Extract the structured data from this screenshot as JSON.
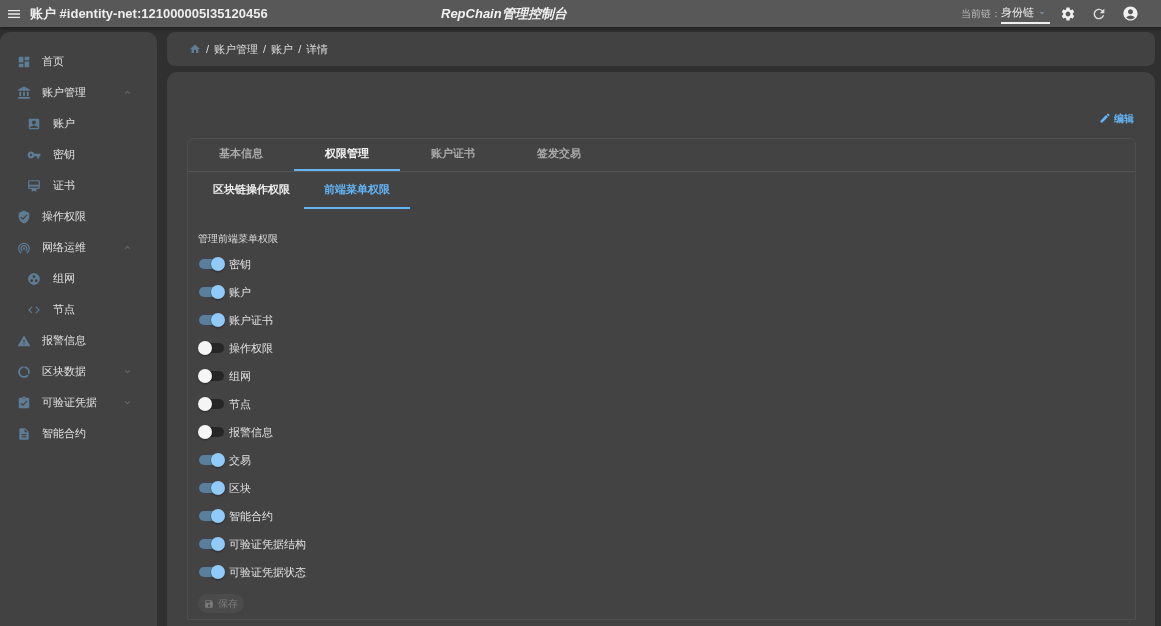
{
  "top_bar": {
    "title": "账户 #identity-net:121000005l35120456",
    "app_name": "RepChain管理控制台",
    "chain_label": "当前链：",
    "chain_select": "身份链"
  },
  "sidebar": {
    "items": [
      {
        "label": "首页"
      },
      {
        "label": "账户管理",
        "expanded": true,
        "children": [
          {
            "label": "账户"
          },
          {
            "label": "密钥"
          },
          {
            "label": "证书"
          }
        ]
      },
      {
        "label": "操作权限"
      },
      {
        "label": "网络运维",
        "expanded": true,
        "children": [
          {
            "label": "组网"
          },
          {
            "label": "节点"
          }
        ]
      },
      {
        "label": "报警信息"
      },
      {
        "label": "区块数据",
        "expanded": false
      },
      {
        "label": "可验证凭据",
        "expanded": false
      },
      {
        "label": "智能合约"
      }
    ]
  },
  "breadcrumb": [
    {
      "separator": "/",
      "label": "账户管理"
    },
    {
      "separator": "/",
      "label": "账户"
    },
    {
      "separator": "/",
      "label": "详情"
    }
  ],
  "edit_button": {
    "label": "编辑"
  },
  "tabs": [
    {
      "label": "基本信息",
      "selected": false
    },
    {
      "label": "权限管理",
      "selected": true
    },
    {
      "label": "账户证书",
      "selected": false
    },
    {
      "label": "签发交易",
      "selected": false
    }
  ],
  "sub_tabs": [
    {
      "label": "区块链操作权限",
      "selected": false
    },
    {
      "label": "前端菜单权限",
      "selected": true
    }
  ],
  "permissions": {
    "heading": "管理前端菜单权限",
    "toggles": [
      {
        "label": "密钥",
        "on": true
      },
      {
        "label": "账户",
        "on": true
      },
      {
        "label": "账户证书",
        "on": true
      },
      {
        "label": "操作权限",
        "on": false
      },
      {
        "label": "组网",
        "on": false
      },
      {
        "label": "节点",
        "on": false
      },
      {
        "label": "报警信息",
        "on": false
      },
      {
        "label": "交易",
        "on": true
      },
      {
        "label": "区块",
        "on": true
      },
      {
        "label": "智能合约",
        "on": true
      },
      {
        "label": "可验证凭据结构",
        "on": true
      },
      {
        "label": "可验证凭据状态",
        "on": true
      }
    ]
  },
  "save_button": {
    "label": "保存",
    "disabled": true
  }
}
